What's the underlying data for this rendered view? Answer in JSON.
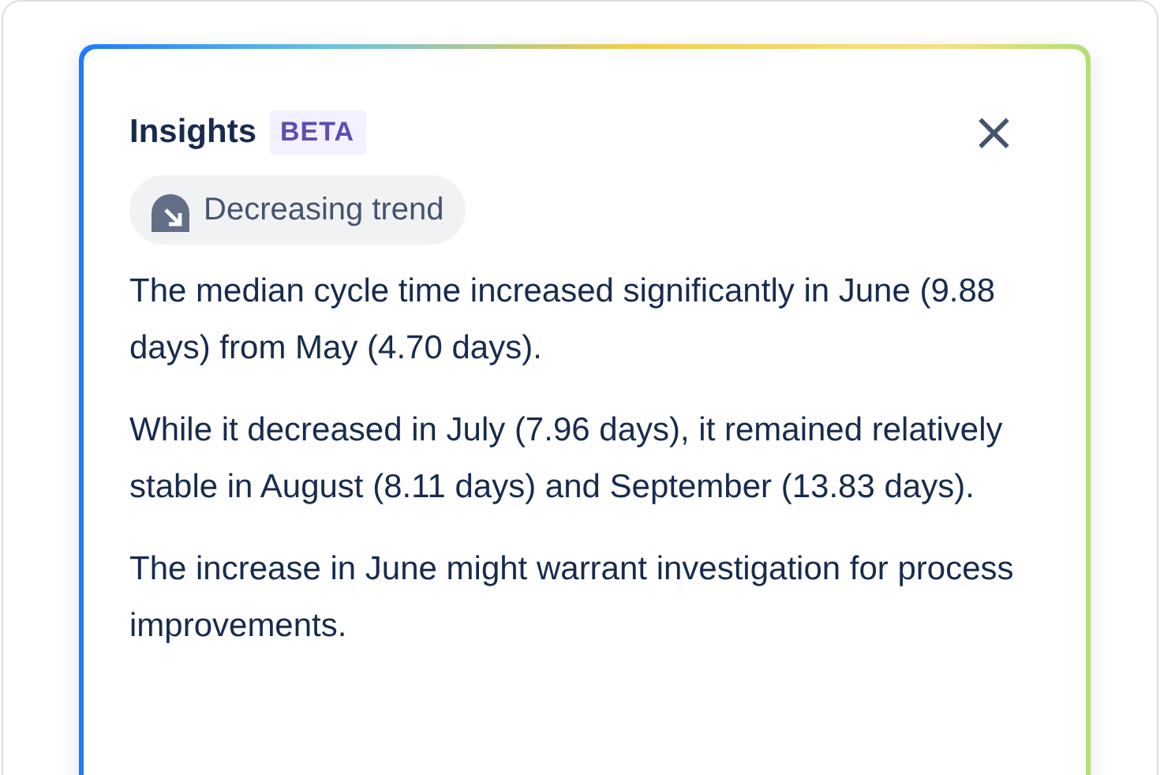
{
  "panel": {
    "title": "Insights",
    "badge": "BETA",
    "close": "×"
  },
  "trend": {
    "label": "Decreasing trend"
  },
  "paragraphs": [
    "The median cycle time increased significantly in June (9.88 days) from May (4.70 days).",
    "While it decreased in July (7.96 days), it remained relatively stable in August (8.11 days) and September (13.83 days).",
    "The increase in June might warrant investigation for process improvements."
  ]
}
